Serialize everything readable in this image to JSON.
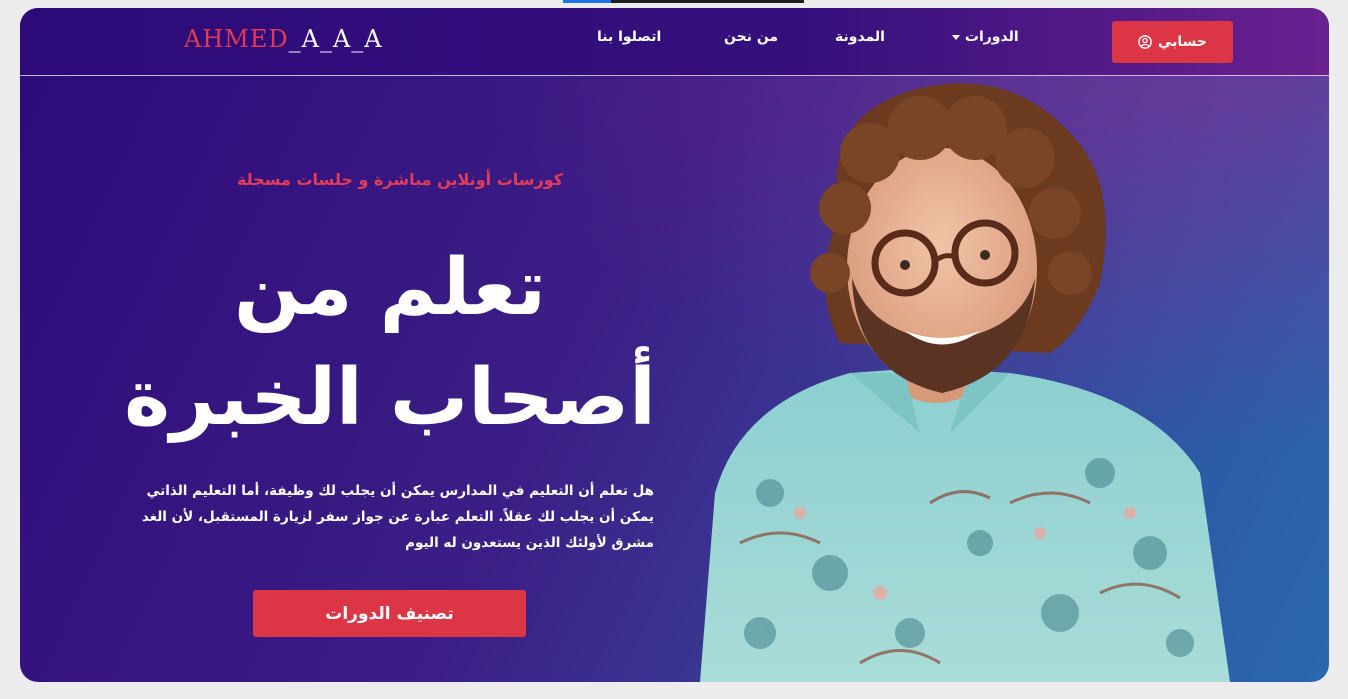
{
  "navbar": {
    "logo_red": "AHMED",
    "logo_white": "_A_A_A",
    "links": {
      "contact": "اتصلوا بنا",
      "about": "من نحن",
      "blog": "المدونة",
      "courses": "الدورات"
    },
    "account_label": "حسابي"
  },
  "hero": {
    "subtitle": "كورسات أونلاين مباشرة و جلسات مسجلة",
    "headline_line1": "تعلم من",
    "headline_line2": "أصحاب الخبرة",
    "description": "هل تعلم أن التعليم في المدارس يمكن أن يجلب لك وظيفة، أما التعليم الذاتي يمكن أن يجلب لك عقلاً. التعلم عبارة عن جواز سفر لزيارة المستقبل، لأن الغد مشرق لأولئك الذين يستعدون له اليوم",
    "cta_label": "تصنيف الدورات"
  },
  "icons": {
    "account": "user-circle-icon",
    "courses_dropdown": "caret-down-icon"
  },
  "colors": {
    "accent": "#dc3545",
    "subtitle": "#e33b5b",
    "bg_start": "#2a0b7a",
    "bg_end": "#2a68ad"
  }
}
